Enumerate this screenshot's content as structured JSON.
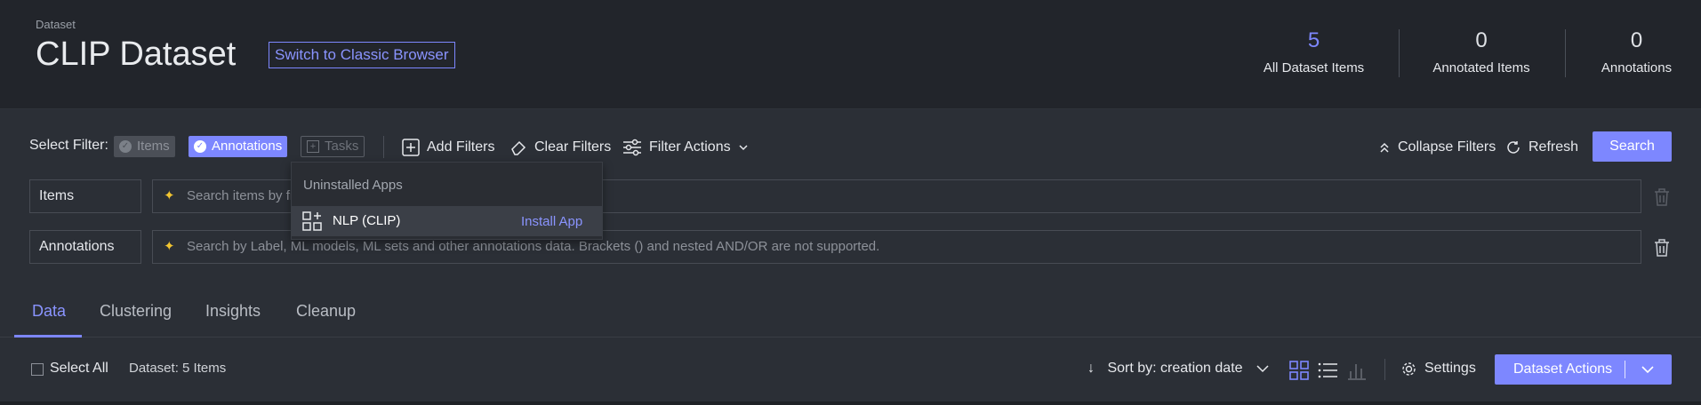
{
  "header": {
    "breadcrumb": "Dataset",
    "title": "CLIP Dataset",
    "classic_button": "Switch to Classic Browser",
    "stats": [
      {
        "value": "5",
        "label": "All Dataset Items"
      },
      {
        "value": "0",
        "label": "Annotated Items"
      },
      {
        "value": "0",
        "label": "Annotations"
      }
    ]
  },
  "filters": {
    "select_label": "Select Filter:",
    "chips": {
      "items": "Items",
      "annotations": "Annotations",
      "tasks": "Tasks"
    },
    "toolbar": {
      "add": "Add Filters",
      "clear": "Clear Filters",
      "actions": "Filter Actions",
      "collapse": "Collapse Filters",
      "refresh": "Refresh",
      "search": "Search"
    },
    "rows": [
      {
        "label": "Items",
        "placeholder": "Search items by fi"
      },
      {
        "label": "Annotations",
        "placeholder": "Search by Label, ML models, ML sets and other annotations data. Brackets () and nested AND/OR are not supported."
      }
    ],
    "hidden_tail": "Search by Label, Ml. models, ML sets and other annotations data. Brackets () and nested AND/OR are not supported."
  },
  "dropdown": {
    "header": "Uninstalled Apps",
    "item_name": "NLP (CLIP)",
    "install_label": "Install App"
  },
  "tabs": [
    "Data",
    "Clustering",
    "Insights",
    "Cleanup"
  ],
  "bottom": {
    "select_all": "Select All",
    "dataset_count": "Dataset: 5 Items",
    "sort": "Sort by: creation date",
    "settings": "Settings",
    "actions": "Dataset Actions"
  },
  "colors": {
    "accent": "#7d87ff",
    "warn_icon": "#f2c531"
  }
}
